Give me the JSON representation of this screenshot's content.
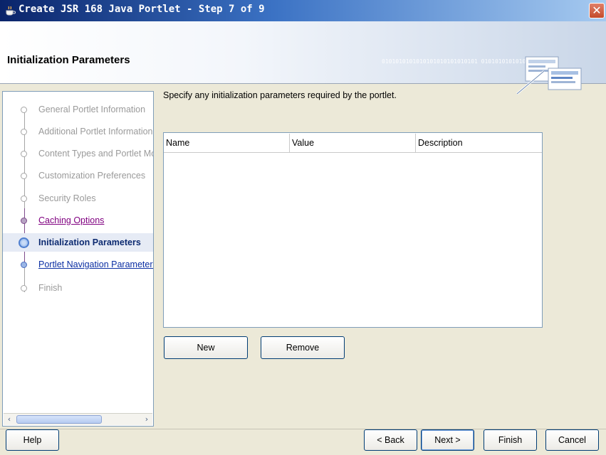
{
  "window": {
    "title": "Create JSR 168 Java Portlet - Step 7 of 9",
    "close_label": "✕"
  },
  "header": {
    "title": "Initialization Parameters",
    "decor_text": "0101010101010101010101010101 0101010101010"
  },
  "nav": {
    "items": [
      {
        "label": "General Portlet Information",
        "state": "disabled"
      },
      {
        "label": "Additional Portlet Information",
        "state": "disabled"
      },
      {
        "label": "Content Types and Portlet Modes",
        "state": "disabled"
      },
      {
        "label": "Customization Preferences",
        "state": "disabled"
      },
      {
        "label": "Security Roles",
        "state": "disabled"
      },
      {
        "label": "Caching Options",
        "state": "visited"
      },
      {
        "label": "Initialization Parameters",
        "state": "current"
      },
      {
        "label": "Portlet Navigation Parameters",
        "state": "link"
      },
      {
        "label": "Finish",
        "state": "disabled"
      }
    ],
    "scroll_left": "‹",
    "scroll_right": "›"
  },
  "content": {
    "instructions": "Specify any initialization parameters required by the portlet.",
    "columns": [
      "Name",
      "Value",
      "Description"
    ],
    "new_label": "New",
    "remove_label": "Remove"
  },
  "footer": {
    "help_label": "Help",
    "back_label": "< Back",
    "next_label": "Next >",
    "finish_label": "Finish",
    "cancel_label": "Cancel"
  }
}
